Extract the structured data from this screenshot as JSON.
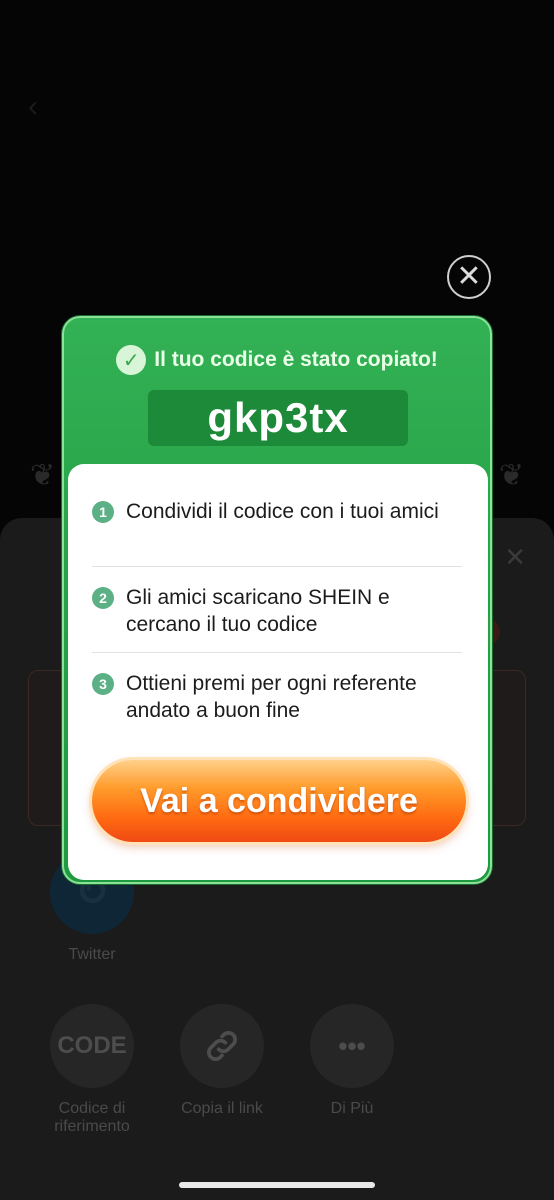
{
  "modal": {
    "header_text": "Il tuo codice è stato copiato!",
    "code": "gkp3tx",
    "steps": [
      {
        "num": "1",
        "text": "Condividi il codice con i tuoi amici"
      },
      {
        "num": "2",
        "text": "Gli amici scaricano SHEIN e cercano il tuo codice"
      },
      {
        "num": "3",
        "text": "Ottieni premi per ogni referente andato a buon fine"
      }
    ],
    "cta_label": "Vai a condividere",
    "close_glyph": "✕"
  },
  "share": {
    "twitter_label": "Twitter",
    "code_icon_text": "CODE",
    "code_label": "Codice di riferimento",
    "copy_link_label": "Copia il link",
    "more_label": "Di Più"
  },
  "colors": {
    "modal_green": "#28a348",
    "cta_orange": "#ff6b12",
    "step_badge": "#5cb085"
  }
}
